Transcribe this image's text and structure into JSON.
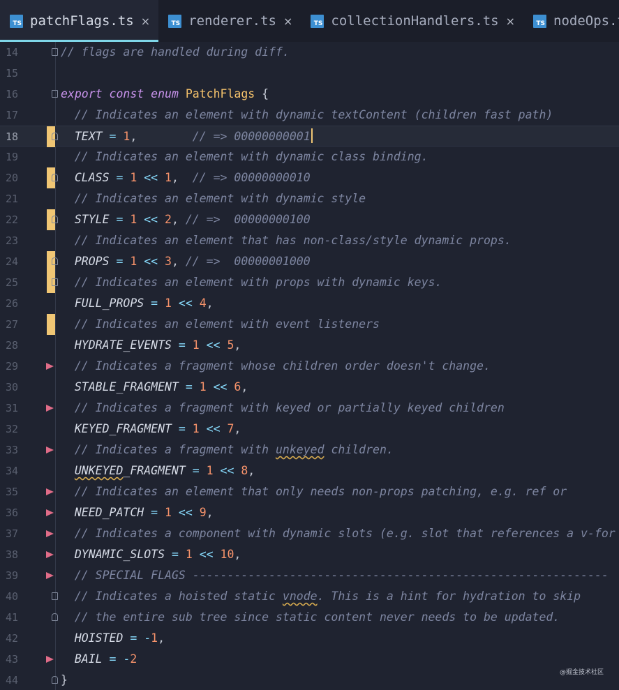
{
  "tabs": [
    {
      "label": "patchFlags.ts",
      "icon": "ts-file-icon",
      "active": true
    },
    {
      "label": "renderer.ts",
      "icon": "ts-file-icon",
      "active": false
    },
    {
      "label": "collectionHandlers.ts",
      "icon": "ts-file-icon",
      "active": false
    },
    {
      "label": "nodeOps.ts",
      "icon": "ts-file-icon",
      "active": false
    }
  ],
  "icon_text": "TS",
  "close_glyph": "×",
  "lines": [
    {
      "n": "14",
      "mark": "",
      "fold": "start",
      "tokens": [
        [
          "c-comment",
          "// flags are handled during diff."
        ]
      ]
    },
    {
      "n": "15",
      "mark": "",
      "fold": "",
      "tokens": []
    },
    {
      "n": "16",
      "mark": "",
      "fold": "start",
      "tokens": [
        [
          "c-kw",
          "export"
        ],
        [
          "",
          " "
        ],
        [
          "c-kw",
          "const"
        ],
        [
          "",
          " "
        ],
        [
          "c-kw",
          "enum"
        ],
        [
          "",
          " "
        ],
        [
          "c-type",
          "PatchFlags"
        ],
        [
          "",
          " "
        ],
        [
          "c-brace",
          "{"
        ]
      ]
    },
    {
      "n": "17",
      "mark": "",
      "fold": "",
      "tokens": [
        [
          "",
          "  "
        ],
        [
          "c-comment",
          "// Indicates an element with dynamic textContent (children fast path)"
        ]
      ]
    },
    {
      "n": "18",
      "mark": "mod",
      "fold": "end",
      "current": true,
      "cursor": true,
      "tokens": [
        [
          "",
          "  TEXT "
        ],
        [
          "c-op",
          "="
        ],
        [
          "",
          " "
        ],
        [
          "c-num",
          "1"
        ],
        [
          "c-punc",
          ","
        ],
        [
          "",
          "        "
        ],
        [
          "c-comment",
          "// => 00000000001"
        ]
      ]
    },
    {
      "n": "19",
      "mark": "",
      "fold": "",
      "tokens": [
        [
          "",
          "  "
        ],
        [
          "c-comment",
          "// Indicates an element with dynamic class binding."
        ]
      ]
    },
    {
      "n": "20",
      "mark": "mod",
      "fold": "end",
      "tokens": [
        [
          "",
          "  CLASS "
        ],
        [
          "c-op",
          "="
        ],
        [
          "",
          " "
        ],
        [
          "c-num",
          "1"
        ],
        [
          "",
          " "
        ],
        [
          "c-op",
          "<<"
        ],
        [
          "",
          " "
        ],
        [
          "c-num",
          "1"
        ],
        [
          "c-punc",
          ","
        ],
        [
          "",
          "  "
        ],
        [
          "c-comment",
          "// => 00000000010"
        ]
      ]
    },
    {
      "n": "21",
      "mark": "",
      "fold": "",
      "tokens": [
        [
          "",
          "  "
        ],
        [
          "c-comment",
          "// Indicates an element with dynamic style"
        ]
      ]
    },
    {
      "n": "22",
      "mark": "mod",
      "fold": "end",
      "tokens": [
        [
          "",
          "  STYLE "
        ],
        [
          "c-op",
          "="
        ],
        [
          "",
          " "
        ],
        [
          "c-num",
          "1"
        ],
        [
          "",
          " "
        ],
        [
          "c-op",
          "<<"
        ],
        [
          "",
          " "
        ],
        [
          "c-num",
          "2"
        ],
        [
          "c-punc",
          ","
        ],
        [
          "",
          " "
        ],
        [
          "c-comment",
          "// =>  00000000100"
        ]
      ]
    },
    {
      "n": "23",
      "mark": "",
      "fold": "",
      "tokens": [
        [
          "",
          "  "
        ],
        [
          "c-comment",
          "// Indicates an element that has non-class/style dynamic props."
        ]
      ]
    },
    {
      "n": "24",
      "mark": "mod",
      "fold": "end",
      "tokens": [
        [
          "",
          "  PROPS "
        ],
        [
          "c-op",
          "="
        ],
        [
          "",
          " "
        ],
        [
          "c-num",
          "1"
        ],
        [
          "",
          " "
        ],
        [
          "c-op",
          "<<"
        ],
        [
          "",
          " "
        ],
        [
          "c-num",
          "3"
        ],
        [
          "c-punc",
          ","
        ],
        [
          "",
          " "
        ],
        [
          "c-comment",
          "// =>  00000001000"
        ]
      ]
    },
    {
      "n": "25",
      "mark": "mod",
      "fold": "start",
      "tokens": [
        [
          "",
          "  "
        ],
        [
          "c-comment",
          "// Indicates an element with props with dynamic keys."
        ]
      ]
    },
    {
      "n": "26",
      "mark": "",
      "fold": "",
      "tokens": [
        [
          "",
          "  FULL_PROPS "
        ],
        [
          "c-op",
          "="
        ],
        [
          "",
          " "
        ],
        [
          "c-num",
          "1"
        ],
        [
          "",
          " "
        ],
        [
          "c-op",
          "<<"
        ],
        [
          "",
          " "
        ],
        [
          "c-num",
          "4"
        ],
        [
          "c-punc",
          ","
        ]
      ]
    },
    {
      "n": "27",
      "mark": "mod",
      "fold": "",
      "tokens": [
        [
          "",
          "  "
        ],
        [
          "c-comment",
          "// Indicates an element with event listeners"
        ]
      ]
    },
    {
      "n": "28",
      "mark": "",
      "fold": "",
      "tokens": [
        [
          "",
          "  HYDRATE_EVENTS "
        ],
        [
          "c-op",
          "="
        ],
        [
          "",
          " "
        ],
        [
          "c-num",
          "1"
        ],
        [
          "",
          " "
        ],
        [
          "c-op",
          "<<"
        ],
        [
          "",
          " "
        ],
        [
          "c-num",
          "5"
        ],
        [
          "c-punc",
          ","
        ]
      ]
    },
    {
      "n": "29",
      "mark": "del",
      "fold": "",
      "tokens": [
        [
          "",
          "  "
        ],
        [
          "c-comment",
          "// Indicates a fragment whose children order doesn't change."
        ]
      ]
    },
    {
      "n": "30",
      "mark": "",
      "fold": "",
      "tokens": [
        [
          "",
          "  STABLE_FRAGMENT "
        ],
        [
          "c-op",
          "="
        ],
        [
          "",
          " "
        ],
        [
          "c-num",
          "1"
        ],
        [
          "",
          " "
        ],
        [
          "c-op",
          "<<"
        ],
        [
          "",
          " "
        ],
        [
          "c-num",
          "6"
        ],
        [
          "c-punc",
          ","
        ]
      ]
    },
    {
      "n": "31",
      "mark": "del",
      "fold": "",
      "tokens": [
        [
          "",
          "  "
        ],
        [
          "c-comment",
          "// Indicates a fragment with keyed or partially keyed children"
        ]
      ]
    },
    {
      "n": "32",
      "mark": "",
      "fold": "",
      "tokens": [
        [
          "",
          "  KEYED_FRAGMENT "
        ],
        [
          "c-op",
          "="
        ],
        [
          "",
          " "
        ],
        [
          "c-num",
          "1"
        ],
        [
          "",
          " "
        ],
        [
          "c-op",
          "<<"
        ],
        [
          "",
          " "
        ],
        [
          "c-num",
          "7"
        ],
        [
          "c-punc",
          ","
        ]
      ]
    },
    {
      "n": "33",
      "mark": "del",
      "fold": "",
      "tokens": [
        [
          "",
          "  "
        ],
        [
          "c-comment",
          "// Indicates a fragment with "
        ],
        [
          "c-comment squiggle",
          "unkeyed"
        ],
        [
          "c-comment",
          " children."
        ]
      ]
    },
    {
      "n": "34",
      "mark": "",
      "fold": "",
      "tokens": [
        [
          "",
          "  "
        ],
        [
          "squiggle",
          "UNKEYED"
        ],
        [
          "",
          "_FRAGMENT "
        ],
        [
          "c-op",
          "="
        ],
        [
          "",
          " "
        ],
        [
          "c-num",
          "1"
        ],
        [
          "",
          " "
        ],
        [
          "c-op",
          "<<"
        ],
        [
          "",
          " "
        ],
        [
          "c-num",
          "8"
        ],
        [
          "c-punc",
          ","
        ]
      ]
    },
    {
      "n": "35",
      "mark": "del",
      "fold": "",
      "tokens": [
        [
          "",
          "  "
        ],
        [
          "c-comment",
          "// Indicates an element that only needs non-props patching, e.g. ref or"
        ]
      ]
    },
    {
      "n": "36",
      "mark": "del",
      "fold": "",
      "tokens": [
        [
          "",
          "  NEED_PATCH "
        ],
        [
          "c-op",
          "="
        ],
        [
          "",
          " "
        ],
        [
          "c-num",
          "1"
        ],
        [
          "",
          " "
        ],
        [
          "c-op",
          "<<"
        ],
        [
          "",
          " "
        ],
        [
          "c-num",
          "9"
        ],
        [
          "c-punc",
          ","
        ]
      ]
    },
    {
      "n": "37",
      "mark": "del",
      "fold": "",
      "tokens": [
        [
          "",
          "  "
        ],
        [
          "c-comment",
          "// Indicates a component with dynamic slots (e.g. slot that references a v-for"
        ]
      ]
    },
    {
      "n": "38",
      "mark": "del",
      "fold": "",
      "tokens": [
        [
          "",
          "  DYNAMIC_SLOTS "
        ],
        [
          "c-op",
          "="
        ],
        [
          "",
          " "
        ],
        [
          "c-num",
          "1"
        ],
        [
          "",
          " "
        ],
        [
          "c-op",
          "<<"
        ],
        [
          "",
          " "
        ],
        [
          "c-num",
          "10"
        ],
        [
          "c-punc",
          ","
        ]
      ]
    },
    {
      "n": "39",
      "mark": "del",
      "fold": "",
      "tokens": [
        [
          "",
          "  "
        ],
        [
          "c-comment",
          "// SPECIAL FLAGS ------------------------------------------------------------"
        ]
      ]
    },
    {
      "n": "40",
      "mark": "",
      "fold": "start",
      "tokens": [
        [
          "",
          "  "
        ],
        [
          "c-comment",
          "// Indicates a hoisted static "
        ],
        [
          "c-comment squiggle",
          "vnode"
        ],
        [
          "c-comment",
          ". This is a hint for hydration to skip"
        ]
      ]
    },
    {
      "n": "41",
      "mark": "",
      "fold": "end",
      "tokens": [
        [
          "",
          "  "
        ],
        [
          "c-comment",
          "// the entire sub tree since static content never needs to be updated."
        ]
      ]
    },
    {
      "n": "42",
      "mark": "",
      "fold": "",
      "tokens": [
        [
          "",
          "  HOISTED "
        ],
        [
          "c-op",
          "="
        ],
        [
          "",
          " "
        ],
        [
          "c-op",
          "-"
        ],
        [
          "c-num",
          "1"
        ],
        [
          "c-punc",
          ","
        ]
      ]
    },
    {
      "n": "43",
      "mark": "del",
      "fold": "",
      "tokens": [
        [
          "",
          "  BAIL "
        ],
        [
          "c-op",
          "="
        ],
        [
          "",
          " "
        ],
        [
          "c-op",
          "-"
        ],
        [
          "c-num",
          "2"
        ]
      ]
    },
    {
      "n": "44",
      "mark": "",
      "fold": "end",
      "tokens": [
        [
          "c-brace",
          "}"
        ]
      ]
    }
  ],
  "watermark": "@掘金技术社区"
}
